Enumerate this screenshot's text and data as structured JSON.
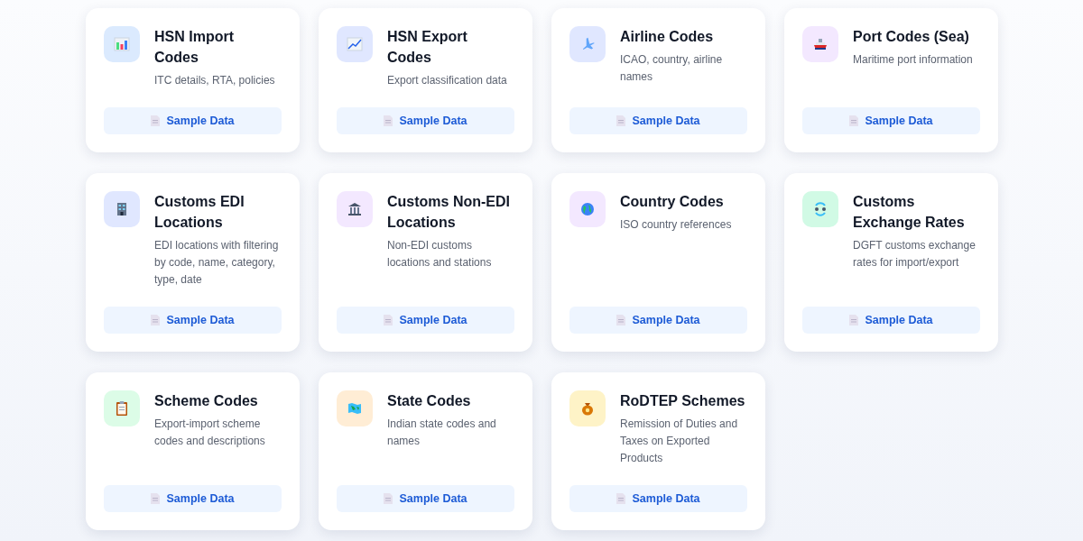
{
  "cards": [
    {
      "title": "HSN Import Codes",
      "description": "ITC details, RTA, policies",
      "color": "#dbeafe",
      "button": "Sample Data"
    },
    {
      "title": "HSN Export Codes",
      "description": "Export classification data",
      "color": "#e0e7ff",
      "button": "Sample Data"
    },
    {
      "title": "Airline Codes",
      "description": "ICAO, country, airline names",
      "color": "#e0e7ff",
      "button": "Sample Data"
    },
    {
      "title": "Port Codes (Sea)",
      "description": "Maritime port information",
      "color": "#f3e8ff",
      "button": "Sample Data"
    },
    {
      "title": "Customs EDI Locations",
      "description": "EDI locations with filtering by code, name, category, type, date",
      "color": "#e0e7ff",
      "button": "Sample Data"
    },
    {
      "title": "Customs Non-EDI Locations",
      "description": "Non-EDI customs locations and stations",
      "color": "#f3e8ff",
      "button": "Sample Data"
    },
    {
      "title": "Country Codes",
      "description": "ISO country references",
      "color": "#f3e8ff",
      "button": "Sample Data"
    },
    {
      "title": "Customs Exchange Rates",
      "description": "DGFT customs exchange rates for import/export",
      "color": "#d1fae5",
      "button": "Sample Data"
    },
    {
      "title": "Scheme Codes",
      "description": "Export-import scheme codes and descriptions",
      "color": "#dcfce7",
      "button": "Sample Data"
    },
    {
      "title": "State Codes",
      "description": "Indian state codes and names",
      "color": "#ffedd5",
      "button": "Sample Data"
    },
    {
      "title": "RoDTEP Schemes",
      "description": "Remission of Duties and Taxes on Exported Products",
      "color": "#fef3c7",
      "button": "Sample Data"
    }
  ]
}
